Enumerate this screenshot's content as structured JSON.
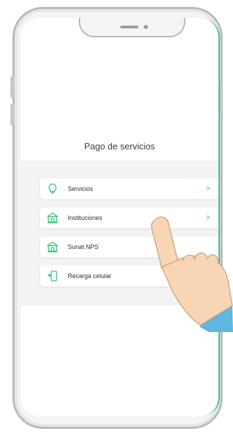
{
  "app": {
    "title": "Pago de servicios"
  },
  "menu": {
    "items": [
      {
        "label": "Servicios",
        "icon": "lightbulb-icon",
        "has_chevron": true
      },
      {
        "label": "Instituciones",
        "icon": "institution-icon",
        "has_chevron": true
      },
      {
        "label": "Sunat NPS",
        "icon": "institution-icon",
        "has_chevron": false
      },
      {
        "label": "Recarga celular",
        "icon": "phone-recharge-icon",
        "has_chevron": false
      }
    ],
    "chevron": ">"
  },
  "colors": {
    "accent": "#34c47a",
    "hand_skin": "#f8d5b4",
    "sleeve": "#5fb6e0"
  }
}
